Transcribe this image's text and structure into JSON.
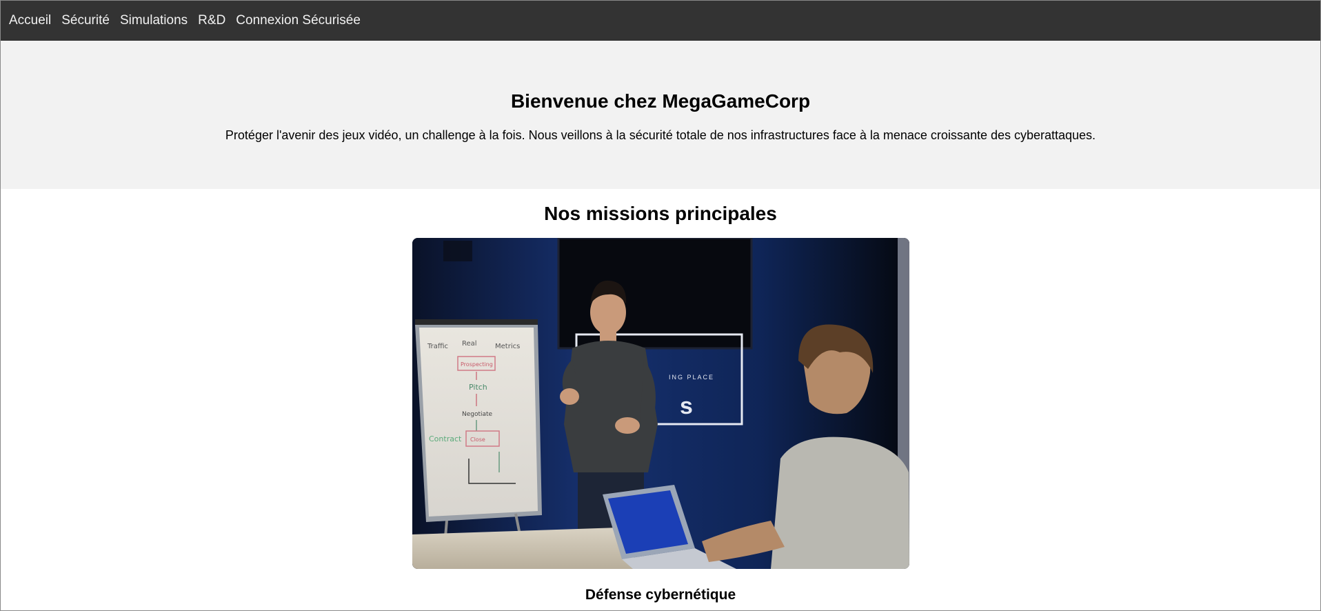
{
  "nav": {
    "items": [
      {
        "label": "Accueil"
      },
      {
        "label": "Sécurité"
      },
      {
        "label": "Simulations"
      },
      {
        "label": "R&D"
      },
      {
        "label": "Connexion Sécurisée"
      }
    ]
  },
  "hero": {
    "title": "Bienvenue chez MegaGameCorp",
    "text": "Protéger l'avenir des jeux vidéo, un challenge à la fois. Nous veillons à la sécurité totale de nos infrastructures face à la menace croissante des cyberattaques."
  },
  "missions": {
    "heading": "Nos missions principales",
    "image": {
      "description_icon": "meeting-photo",
      "whiteboard": {
        "top_labels": [
          "Traffic",
          "Real",
          "Metrics"
        ],
        "flow": [
          "Prospecting",
          "Pitch",
          "Negotiate",
          "Close"
        ],
        "side_label": "Contract"
      },
      "sign_text": "ING PLACE"
    },
    "item_title": "Défense cybernétique"
  },
  "colors": {
    "nav_bg": "#333333",
    "nav_text": "#f2f2f2",
    "hero_bg": "#f2f2f2"
  }
}
